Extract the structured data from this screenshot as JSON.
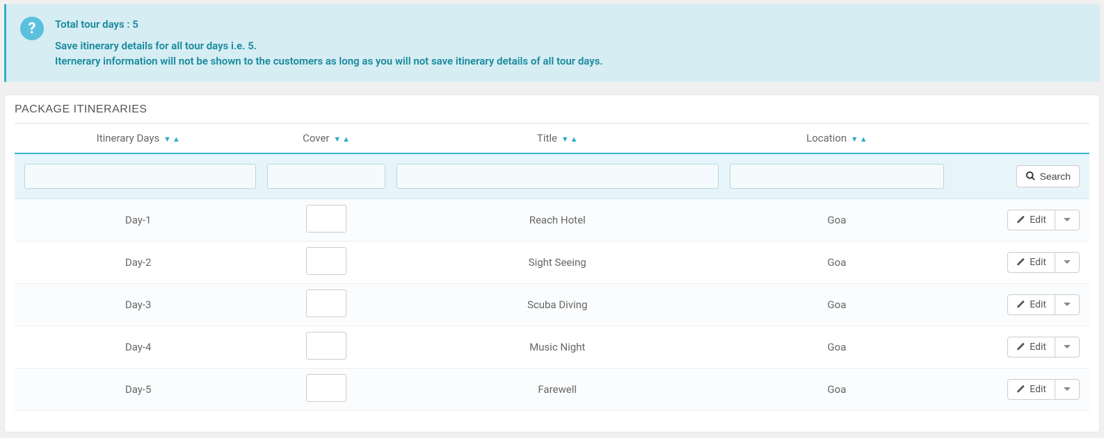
{
  "alert": {
    "line1": "Total tour days : 5",
    "line2": "Save itinerary details for all tour days i.e. 5.",
    "line3": "Iternerary information will not be shown to the customers as long as you will not save itinerary details of all tour days."
  },
  "panel": {
    "title": "PACKAGE ITINERARIES"
  },
  "columns": {
    "days": "Itinerary Days",
    "cover": "Cover",
    "title": "Title",
    "location": "Location"
  },
  "search": {
    "button": "Search"
  },
  "edit": {
    "label": "Edit"
  },
  "rows": [
    {
      "day": "Day-1",
      "title": "Reach Hotel",
      "location": "Goa"
    },
    {
      "day": "Day-2",
      "title": "Sight Seeing",
      "location": "Goa"
    },
    {
      "day": "Day-3",
      "title": "Scuba Diving",
      "location": "Goa"
    },
    {
      "day": "Day-4",
      "title": "Music Night",
      "location": "Goa"
    },
    {
      "day": "Day-5",
      "title": "Farewell",
      "location": "Goa"
    }
  ]
}
